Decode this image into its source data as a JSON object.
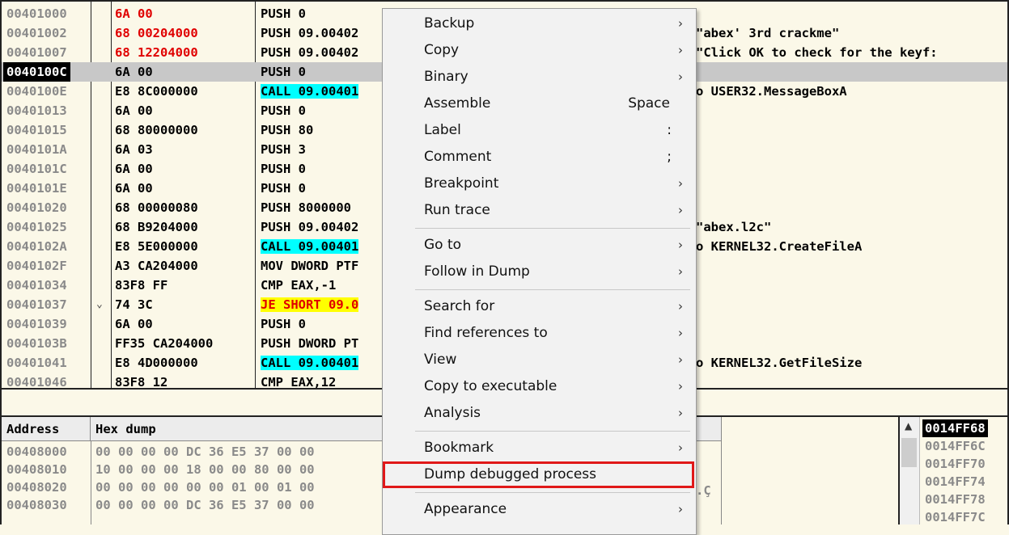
{
  "disasm": {
    "rows": [
      {
        "addr": "00401000",
        "hex": "6A 00",
        "hex_red": true,
        "arrow": "",
        "dis": "PUSH 0",
        "hl": "",
        "cmt": ""
      },
      {
        "addr": "00401002",
        "hex": "68 00204000",
        "hex_red": true,
        "arrow": "",
        "dis": "PUSH 09.00402",
        "hl": "",
        "cmt": "\"abex' 3rd crackme\""
      },
      {
        "addr": "00401007",
        "hex": "68 12204000",
        "hex_red": true,
        "arrow": "",
        "dis": "PUSH 09.00402",
        "hl": "",
        "cmt": "\"Click OK to check for the keyf:"
      },
      {
        "addr": "0040100C",
        "hex": "6A 00",
        "hex_red": false,
        "arrow": "",
        "dis": "PUSH 0",
        "hl": "",
        "cmt": "",
        "selected": true
      },
      {
        "addr": "0040100E",
        "hex": "E8 8C000000",
        "hex_red": false,
        "arrow": "",
        "dis": "CALL 09.00401",
        "hl": "cyan",
        "cmt": "o USER32.MessageBoxA"
      },
      {
        "addr": "00401013",
        "hex": "6A 00",
        "hex_red": false,
        "arrow": "",
        "dis": "PUSH 0",
        "hl": "",
        "cmt": ""
      },
      {
        "addr": "00401015",
        "hex": "68 80000000",
        "hex_red": false,
        "arrow": "",
        "dis": "PUSH 80",
        "hl": "",
        "cmt": ""
      },
      {
        "addr": "0040101A",
        "hex": "6A 03",
        "hex_red": false,
        "arrow": "",
        "dis": "PUSH 3",
        "hl": "",
        "cmt": ""
      },
      {
        "addr": "0040101C",
        "hex": "6A 00",
        "hex_red": false,
        "arrow": "",
        "dis": "PUSH 0",
        "hl": "",
        "cmt": ""
      },
      {
        "addr": "0040101E",
        "hex": "6A 00",
        "hex_red": false,
        "arrow": "",
        "dis": "PUSH 0",
        "hl": "",
        "cmt": ""
      },
      {
        "addr": "00401020",
        "hex": "68 00000080",
        "hex_red": false,
        "arrow": "",
        "dis": "PUSH 8000000",
        "hl": "",
        "cmt": ""
      },
      {
        "addr": "00401025",
        "hex": "68 B9204000",
        "hex_red": false,
        "arrow": "",
        "dis": "PUSH 09.00402",
        "hl": "",
        "cmt": "\"abex.l2c\""
      },
      {
        "addr": "0040102A",
        "hex": "E8 5E000000",
        "hex_red": false,
        "arrow": "",
        "dis": "CALL 09.00401",
        "hl": "cyan",
        "cmt": "o KERNEL32.CreateFileA"
      },
      {
        "addr": "0040102F",
        "hex": "A3 CA204000",
        "hex_red": false,
        "arrow": "",
        "dis": "MOV DWORD PTF",
        "hl": "",
        "cmt": ""
      },
      {
        "addr": "00401034",
        "hex": "83F8 FF",
        "hex_red": false,
        "arrow": "",
        "dis": "CMP EAX,-1",
        "hl": "",
        "cmt": ""
      },
      {
        "addr": "00401037",
        "hex": "74 3C",
        "hex_red": false,
        "arrow": "⌄",
        "dis": "JE SHORT 09.0",
        "hl": "yellow",
        "cmt": ""
      },
      {
        "addr": "00401039",
        "hex": "6A 00",
        "hex_red": false,
        "arrow": "",
        "dis": "PUSH 0",
        "hl": "",
        "cmt": ""
      },
      {
        "addr": "0040103B",
        "hex": "FF35 CA204000",
        "hex_red": false,
        "arrow": "",
        "dis": "PUSH DWORD PT",
        "hl": "",
        "cmt": ""
      },
      {
        "addr": "00401041",
        "hex": "E8 4D000000",
        "hex_red": false,
        "arrow": "",
        "dis": "CALL 09.00401",
        "hl": "cyan",
        "cmt": "o KERNEL32.GetFileSize"
      },
      {
        "addr": "00401046",
        "hex": "83F8 12",
        "hex_red": false,
        "arrow": "",
        "dis": "CMP EAX,12",
        "hl": "",
        "cmt": ""
      }
    ]
  },
  "dump": {
    "header_address": "Address",
    "header_hex": "Hex dump",
    "rows": [
      {
        "addr": "00408000",
        "hex": "00 00 00 00 DC 36 E5 37 00 00"
      },
      {
        "addr": "00408010",
        "hex": "10 00 00 00 18 00 00 80 00 00"
      },
      {
        "addr": "00408020",
        "hex": "00 00 00 00 00 00 01 00 01 00"
      },
      {
        "addr": "00408030",
        "hex": "00 00 00 00 DC 36 E5 37 00 00"
      }
    ],
    "ascii_fragment": ".Ç"
  },
  "stack": {
    "rows": [
      "0014FF68",
      "0014FF6C",
      "0014FF70",
      "0014FF74",
      "0014FF78",
      "0014FF7C"
    ]
  },
  "menu": {
    "items": [
      {
        "label": "Backup",
        "shortcut": "",
        "submenu": true
      },
      {
        "label": "Copy",
        "shortcut": "",
        "submenu": true
      },
      {
        "label": "Binary",
        "shortcut": "",
        "submenu": true
      },
      {
        "label": "Assemble",
        "shortcut": "Space",
        "submenu": false
      },
      {
        "label": "Label",
        "shortcut": ":",
        "submenu": false
      },
      {
        "label": "Comment",
        "shortcut": ";",
        "submenu": false
      },
      {
        "label": "Breakpoint",
        "shortcut": "",
        "submenu": true
      },
      {
        "label": "Run trace",
        "shortcut": "",
        "submenu": true
      },
      {
        "sep": true
      },
      {
        "label": "Go to",
        "shortcut": "",
        "submenu": true
      },
      {
        "label": "Follow in Dump",
        "shortcut": "",
        "submenu": true
      },
      {
        "sep": true
      },
      {
        "label": "Search for",
        "shortcut": "",
        "submenu": true
      },
      {
        "label": "Find references to",
        "shortcut": "",
        "submenu": true
      },
      {
        "label": "View",
        "shortcut": "",
        "submenu": true
      },
      {
        "label": "Copy to executable",
        "shortcut": "",
        "submenu": true
      },
      {
        "label": "Analysis",
        "shortcut": "",
        "submenu": true
      },
      {
        "sep": true
      },
      {
        "label": "Bookmark",
        "shortcut": "",
        "submenu": true
      },
      {
        "label": "Dump debugged process",
        "shortcut": "",
        "submenu": false,
        "highlighted": true
      },
      {
        "sep": true
      },
      {
        "label": "Appearance",
        "shortcut": "",
        "submenu": true
      }
    ],
    "highlight_color": "#e01818"
  },
  "colors": {
    "background": "#fbf8e8",
    "cyan": "#00ffff",
    "yellow": "#ffff00",
    "red": "#e00000"
  }
}
